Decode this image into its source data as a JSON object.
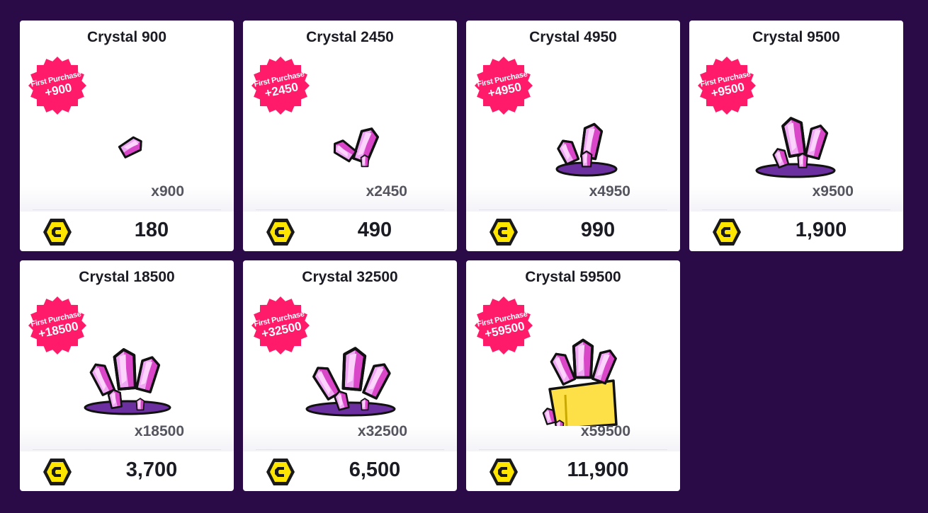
{
  "currency_icon": "coin-c-icon",
  "colors": {
    "background": "#2a0b48",
    "badge": "#ff1a6a",
    "crystal": "#e879f9",
    "chest": "#fde047"
  },
  "cards": [
    {
      "title": "Crystal 900",
      "badge_label": "First Purchase",
      "badge_bonus": "+900",
      "amount": "x900",
      "price": "180",
      "art": "crystal-single"
    },
    {
      "title": "Crystal 2450",
      "badge_label": "First Purchase",
      "badge_bonus": "+2450",
      "amount": "x2450",
      "price": "490",
      "art": "crystal-pair"
    },
    {
      "title": "Crystal 4950",
      "badge_label": "First Purchase",
      "badge_bonus": "+4950",
      "amount": "x4950",
      "price": "990",
      "art": "crystal-small-pile"
    },
    {
      "title": "Crystal 9500",
      "badge_label": "First Purchase",
      "badge_bonus": "+9500",
      "amount": "x9500",
      "price": "1,900",
      "art": "crystal-pile"
    },
    {
      "title": "Crystal 18500",
      "badge_label": "First Purchase",
      "badge_bonus": "+18500",
      "amount": "x18500",
      "price": "3,700",
      "art": "crystal-cluster"
    },
    {
      "title": "Crystal 32500",
      "badge_label": "First Purchase",
      "badge_bonus": "+32500",
      "amount": "x32500",
      "price": "6,500",
      "art": "crystal-large-cluster"
    },
    {
      "title": "Crystal 59500",
      "badge_label": "First Purchase",
      "badge_bonus": "+59500",
      "amount": "x59500",
      "price": "11,900",
      "art": "crystal-chest"
    }
  ]
}
